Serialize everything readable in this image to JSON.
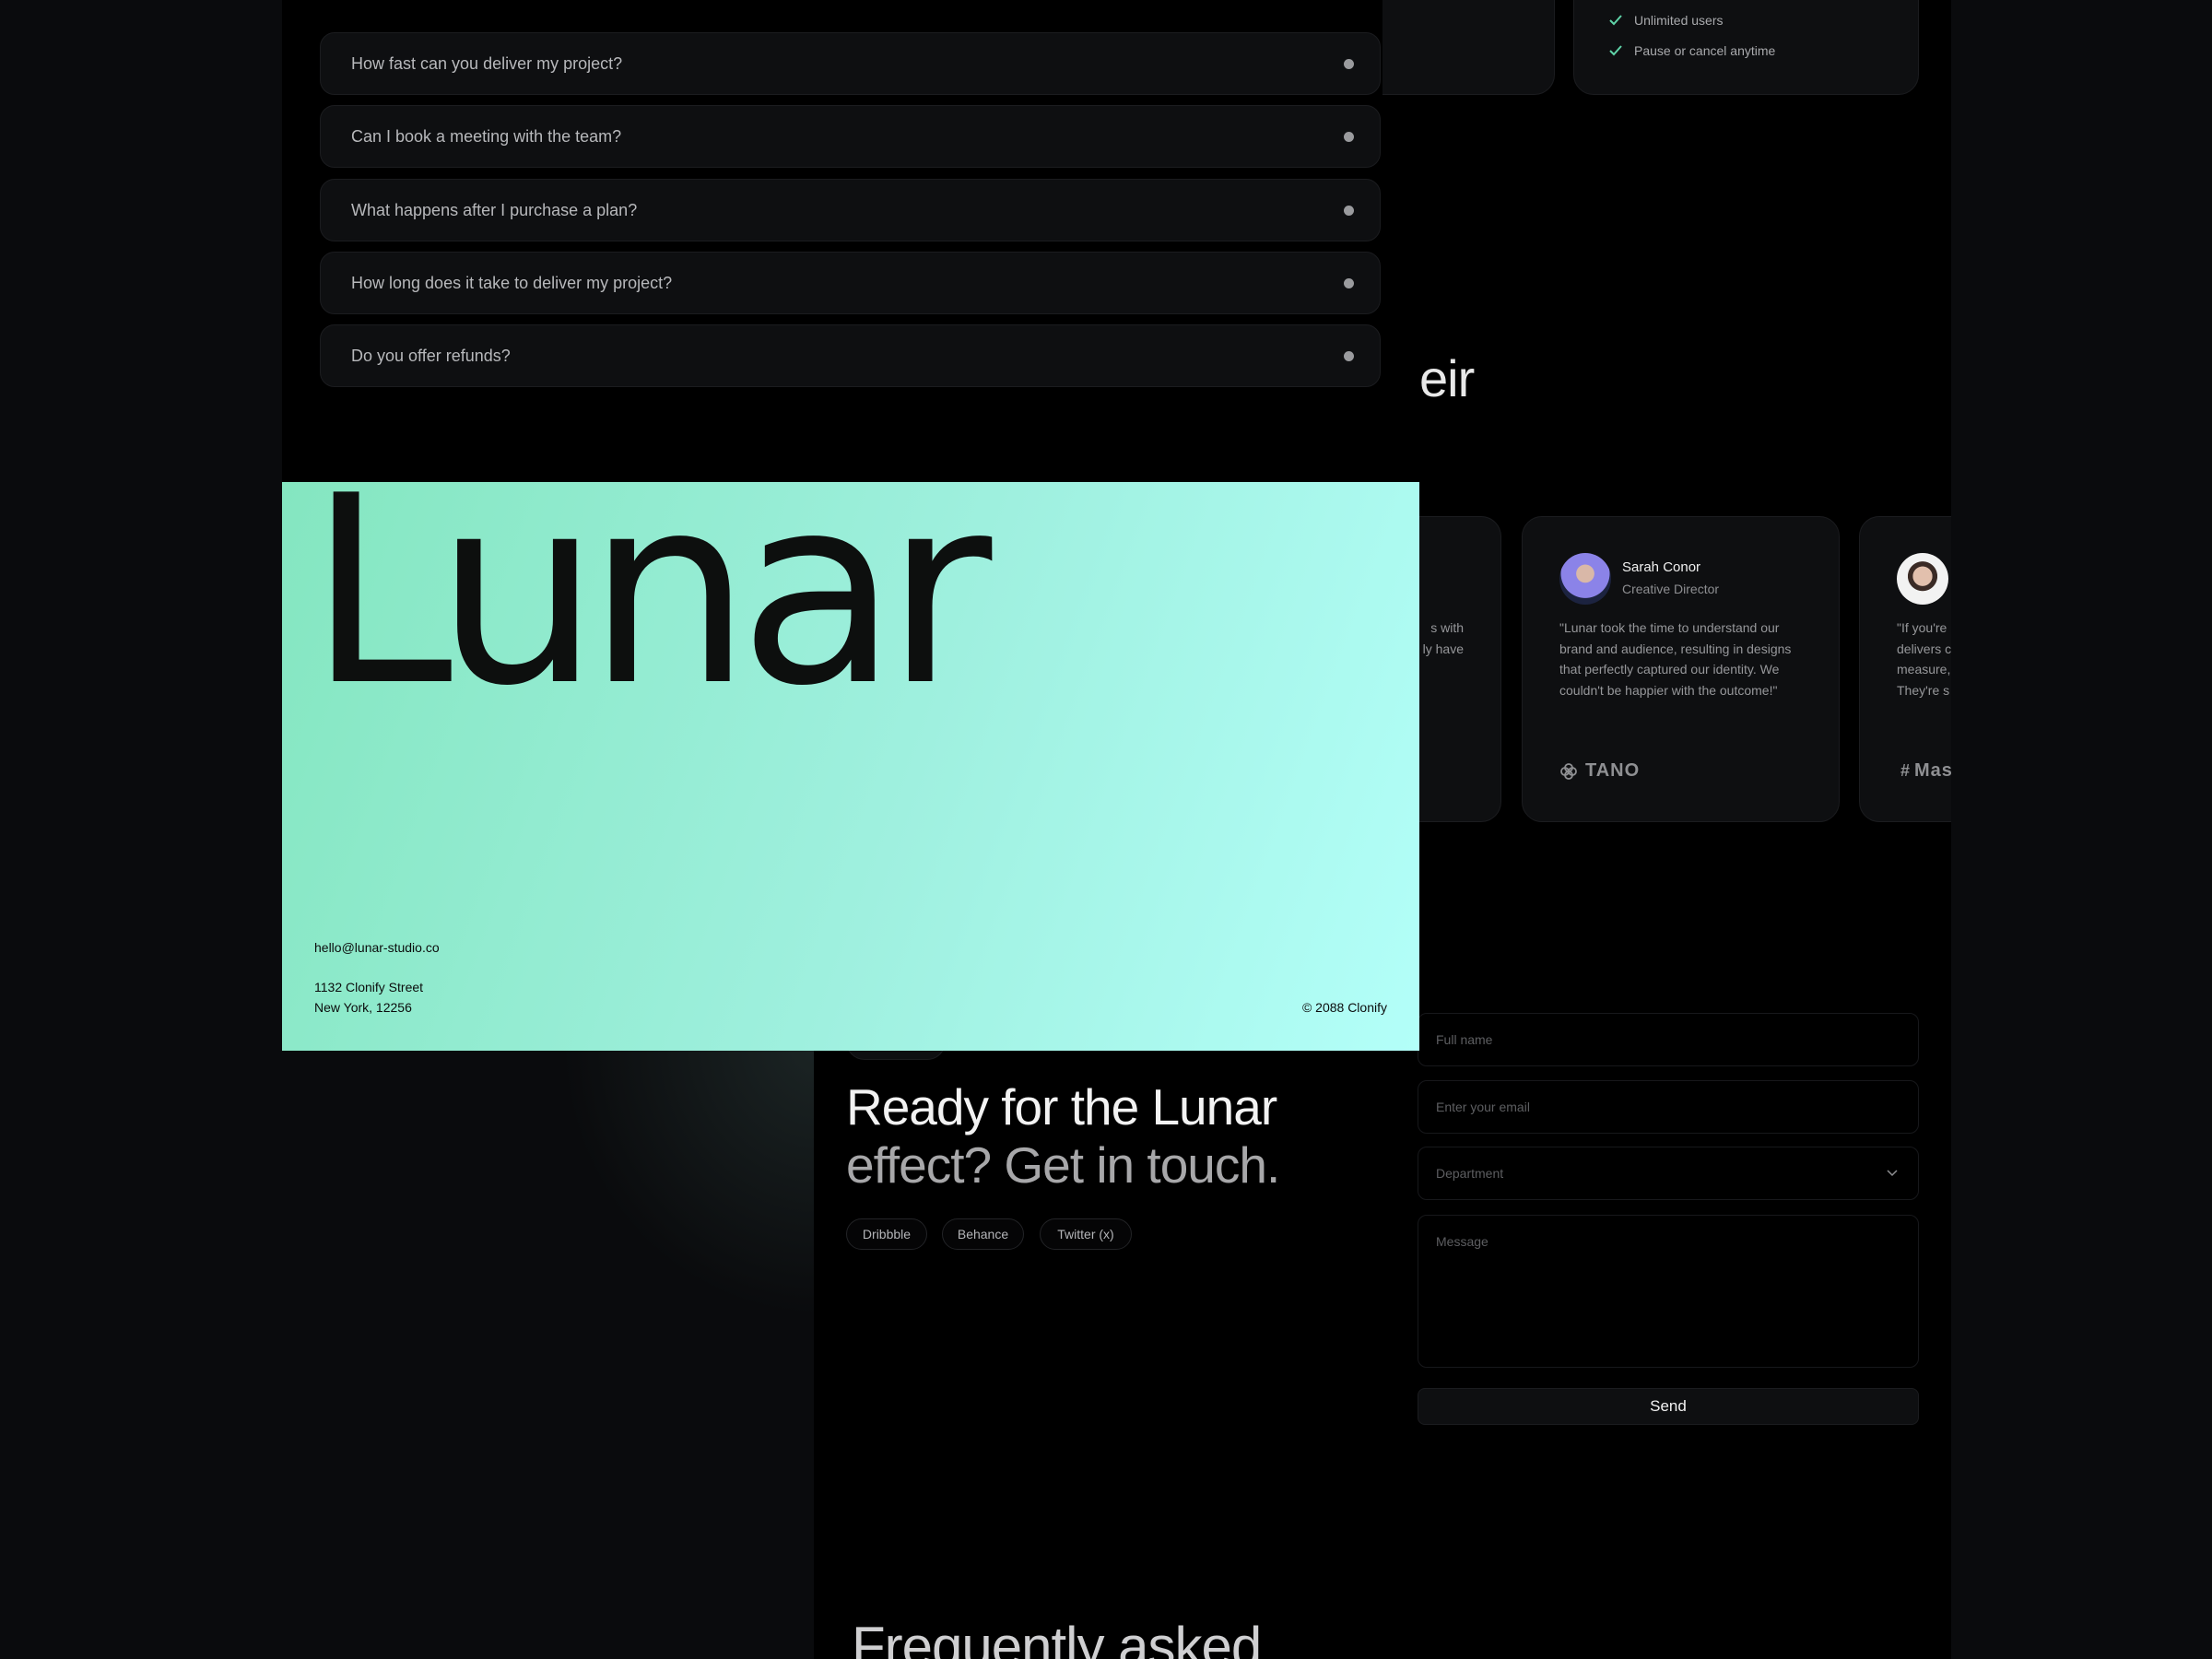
{
  "faq": {
    "items": [
      "How fast can you deliver my project?",
      "Can I book a meeting with the team?",
      "What happens after I purchase a plan?",
      "How long does it take to deliver my project?",
      "Do you offer refunds?"
    ]
  },
  "pricing": {
    "features": [
      "Unlimited users",
      "Pause or cancel anytime"
    ],
    "check_color": "#5fd3a8"
  },
  "testimonials": {
    "heading_fragment": "eir",
    "partial_card": {
      "lines": [
        "s with",
        "ly have"
      ]
    },
    "cards": [
      {
        "name": "Sarah Conor",
        "role": "Creative Director",
        "quote": [
          "\"Lunar took the time to understand our",
          "brand and audience, resulting in designs",
          "that perfectly captured our identity. We",
          "couldn't be happier with the outcome!\""
        ],
        "company": "TANO",
        "company_icon": "flower-icon"
      },
      {
        "quote": [
          "\"If you're",
          "delivers c",
          "measure,",
          "They're s"
        ],
        "company": "Mas",
        "company_icon": "hash-icon"
      }
    ]
  },
  "footer_card": {
    "logo": "Lunar",
    "email": "hello@lunar-studio.co",
    "address_line1": "1132 Clonify Street",
    "address_line2": "New York, 12256",
    "copyright": "© 2088 Clonify",
    "gradient": [
      "#84e6c0",
      "#b3fff9"
    ]
  },
  "contact": {
    "headline_line1": "Ready for the Lunar",
    "headline_line2": "effect? Get in touch.",
    "socials": [
      "Dribbble",
      "Behance",
      "Twitter (x)"
    ],
    "form": {
      "full_name_placeholder": "Full name",
      "email_placeholder": "Enter your email",
      "department_placeholder": "Department",
      "message_placeholder": "Message",
      "send_label": "Send"
    }
  },
  "faq_section": {
    "heading": "Frequently asked"
  }
}
